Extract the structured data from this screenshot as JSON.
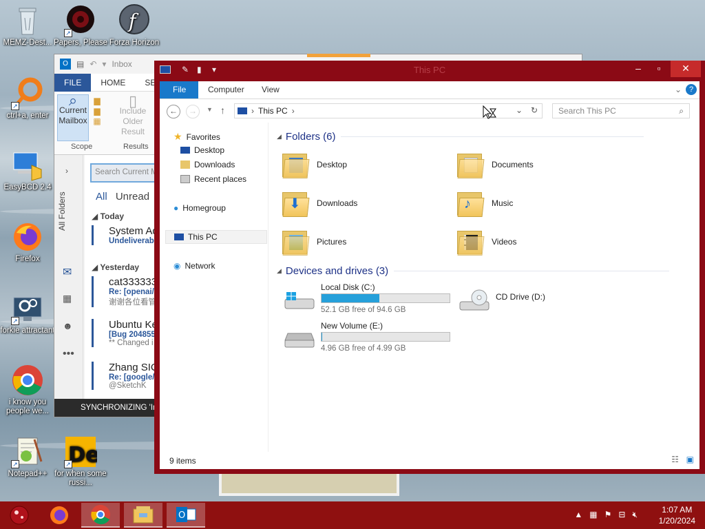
{
  "desktop": {
    "icons": [
      {
        "label": "MEMZ-Dest..."
      },
      {
        "label": "Papers, Please"
      },
      {
        "label": "Forza Horizon"
      },
      {
        "label": "ctrl+a, enter"
      },
      {
        "label": "EasyBCD 2.4"
      },
      {
        "label": "Firefox"
      },
      {
        "label": "forkie attractant"
      },
      {
        "label": "i know you people we..."
      },
      {
        "label": "Notepad++"
      },
      {
        "label": "for when some russi..."
      }
    ]
  },
  "outlook": {
    "title_fragment": "Inbox",
    "ribbon_tabs": [
      "FILE",
      "HOME",
      "SE"
    ],
    "ribbon": {
      "current_mailbox": "Current Mailbox",
      "include_older": "Include Older Result",
      "scope_label": "Scope",
      "results_label": "Results"
    },
    "side_label": "All Folders",
    "search_placeholder": "Search Current M",
    "filter_all": "All",
    "filter_unread": "Unread",
    "sections": [
      "Today",
      "Yesterday"
    ],
    "mails": [
      {
        "from": "System Ad",
        "subject": "Undeliverabl",
        "preview": ""
      },
      {
        "from": "cat333333",
        "subject": "Re: [openai/",
        "preview": "谢谢各位看管"
      },
      {
        "from": "Ubuntu Ke",
        "subject": "[Bug 204855",
        "preview": "** Changed i"
      },
      {
        "from": "Zhang SIC",
        "subject": "Re: [google/",
        "preview": "@SketchK"
      }
    ],
    "status": "SYNCHRONIZING  'Ini"
  },
  "explorer": {
    "title": "This PC",
    "tabs": {
      "file": "File",
      "computer": "Computer",
      "view": "View"
    },
    "address": "This PC",
    "search_placeholder": "Search This PC",
    "nav": {
      "favorites": "Favorites",
      "desktop": "Desktop",
      "downloads": "Downloads",
      "recent": "Recent places",
      "homegroup": "Homegroup",
      "thispc": "This PC",
      "network": "Network"
    },
    "folders_header": "Folders (6)",
    "folders": [
      {
        "name": "Desktop"
      },
      {
        "name": "Documents"
      },
      {
        "name": "Downloads"
      },
      {
        "name": "Music"
      },
      {
        "name": "Pictures"
      },
      {
        "name": "Videos"
      }
    ],
    "drives_header": "Devices and drives (3)",
    "drives": [
      {
        "name": "Local Disk (C:)",
        "free": "52.1 GB free of 94.6 GB",
        "used_fraction": 0.449
      },
      {
        "name": "CD Drive (D:)",
        "free": "",
        "used_fraction": 0
      },
      {
        "name": "New Volume (E:)",
        "free": "4.96 GB free of 4.99 GB",
        "used_fraction": 0.006
      }
    ],
    "status": "9 items"
  },
  "taskbar": {
    "time": "1:07 AM",
    "date": "1/20/2024"
  }
}
